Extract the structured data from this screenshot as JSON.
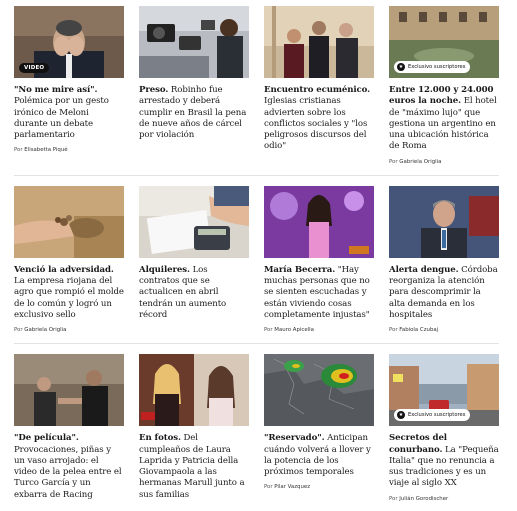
{
  "rows": [
    [
      {
        "kicker": "\"No me mire así\".",
        "headline": "Polémica por un gesto irónico de Meloni durante un debate parlamentario",
        "author_prefix": "Por",
        "author": "Elisabetta Piqué",
        "badge": "VIDEO",
        "image": "man-covering-face"
      },
      {
        "kicker": "Preso.",
        "headline": "Robinho fue arrestado y deberá cumplir en Brasil la pena de nueve años de cárcel por violación",
        "author_prefix": "",
        "author": "",
        "badge": "",
        "image": "reporters-crowd"
      },
      {
        "kicker": "Encuentro ecuménico.",
        "headline": "Iglesias cristianas advierten sobre los conflictos sociales y \"los peligrosos discursos del odio\"",
        "author_prefix": "",
        "author": "",
        "badge": "",
        "image": "religious-leaders"
      },
      {
        "kicker": "Entre 12.000 y 24.000 euros la noche.",
        "headline": "El hotel de \"máximo lujo\" que gestiona un argentino en una ubicación histórica de Roma",
        "author_prefix": "Por",
        "author": "Gabriela Origlia",
        "badge": "Exclusivo suscriptores",
        "image": "rome-hotel"
      }
    ],
    [
      {
        "kicker": "Venció la adversidad.",
        "headline": "La empresa riojana del agro que rompió el molde de lo común y logró un exclusivo sello",
        "author_prefix": "Por",
        "author": "Gabriela Origlia",
        "badge": "",
        "image": "hand-walnuts"
      },
      {
        "kicker": "Alquileres.",
        "headline": "Los contratos que se actualicen en abril tendrán un aumento récord",
        "author_prefix": "",
        "author": "",
        "badge": "",
        "image": "calculator-desk"
      },
      {
        "kicker": "María Becerra.",
        "headline": "\"Hay muchas personas que no se sienten escuchadas y están viviendo cosas completamente injustas\"",
        "author_prefix": "Por",
        "author": "Mauro Apicella",
        "badge": "",
        "image": "singer-purple"
      },
      {
        "kicker": "Alerta dengue.",
        "headline": "Córdoba reorganiza la atención para descomprimir la alta demanda en los hospitales",
        "author_prefix": "Por",
        "author": "Fabiola Czubaj",
        "badge": "",
        "image": "official-speaking"
      }
    ],
    [
      {
        "kicker": "\"De película\".",
        "headline": "Provocaciones, piñas y un vaso arrojado: el video de la pelea entre el Turco García y un exbarra de Racing",
        "author_prefix": "",
        "author": "",
        "badge": "",
        "image": "fight-scene"
      },
      {
        "kicker": "En fotos.",
        "headline": "Del cumpleaños de Laura Laprida y Patricia della Giovampaola a las hermanas Marull junto a sus familias",
        "author_prefix": "",
        "author": "",
        "badge": "",
        "image": "two-women"
      },
      {
        "kicker": "\"Reservado\".",
        "headline": "Anticipan cuándo volverá a llover y la potencia de los próximos temporales",
        "author_prefix": "Por",
        "author": "Pilar Vazquez",
        "badge": "",
        "image": "weather-radar"
      },
      {
        "kicker": "Secretos del conurbano.",
        "headline": "La \"Pequeña Italia\" que no renuncia a sus tradiciones y es un viaje al siglo XX",
        "author_prefix": "Por",
        "author": "Julián Gorodischer",
        "badge": "Exclusivo suscriptores",
        "image": "street-view"
      }
    ]
  ],
  "colors": {
    "text": "#1a1a1a",
    "author": "#555555",
    "divider": "#e2e2e2",
    "badge_dark": "#111111"
  }
}
